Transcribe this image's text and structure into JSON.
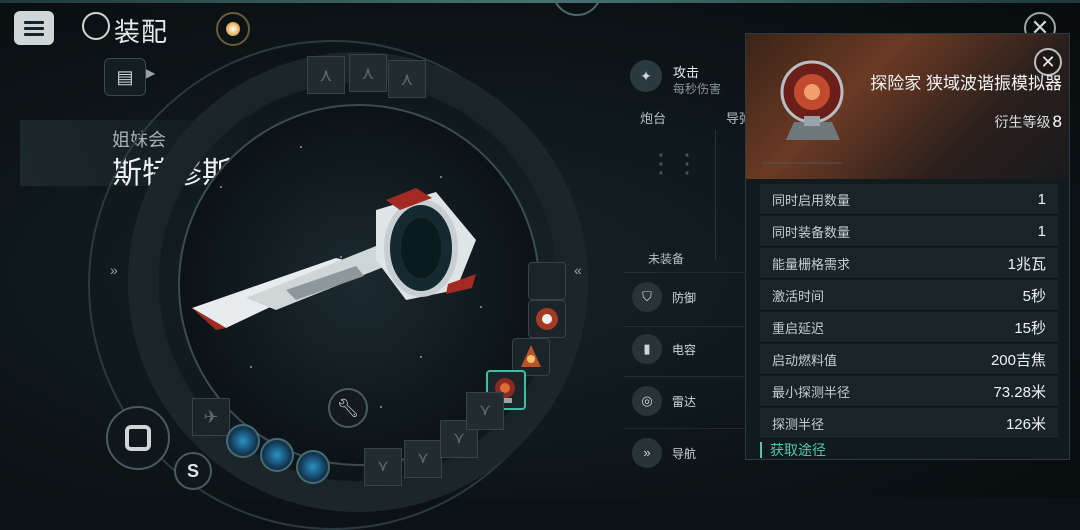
{
  "header": {
    "title": "装配",
    "close_symbol": "✕"
  },
  "ship": {
    "faction": "姐妹会",
    "class_name": "斯特修斯级",
    "class_arrow": "»"
  },
  "side_arrows": {
    "left": "»",
    "right": "«"
  },
  "middle": {
    "attack_label": "攻击",
    "attack_sub": "每秒伤害",
    "turret_label": "炮台",
    "missile_label": "导弹",
    "unequipped": "未装备",
    "attributes": [
      {
        "label": "防御",
        "icon": "shield-icon"
      },
      {
        "label": "电容",
        "icon": "capacitor-icon"
      },
      {
        "label": "雷达",
        "icon": "radar-icon"
      },
      {
        "label": "导航",
        "icon": "navigation-icon"
      }
    ]
  },
  "module": {
    "name": "探险家 狭域波谐振模拟器",
    "level_label": "衍生等级",
    "level_value": "8",
    "stats": [
      {
        "label": "同时启用数量",
        "value": "1"
      },
      {
        "label": "同时装备数量",
        "value": "1"
      },
      {
        "label": "能量栅格需求",
        "value": "1兆瓦"
      },
      {
        "label": "激活时间",
        "value": "5秒"
      },
      {
        "label": "重启延迟",
        "value": "15秒"
      },
      {
        "label": "启动燃料值",
        "value": "200吉焦"
      },
      {
        "label": "最小探测半径",
        "value": "73.28米"
      },
      {
        "label": "探测半径",
        "value": "126米"
      }
    ],
    "acquire_label": "获取途径"
  },
  "colors": {
    "accent": "#53c6b3",
    "panel": "#111a1d"
  }
}
